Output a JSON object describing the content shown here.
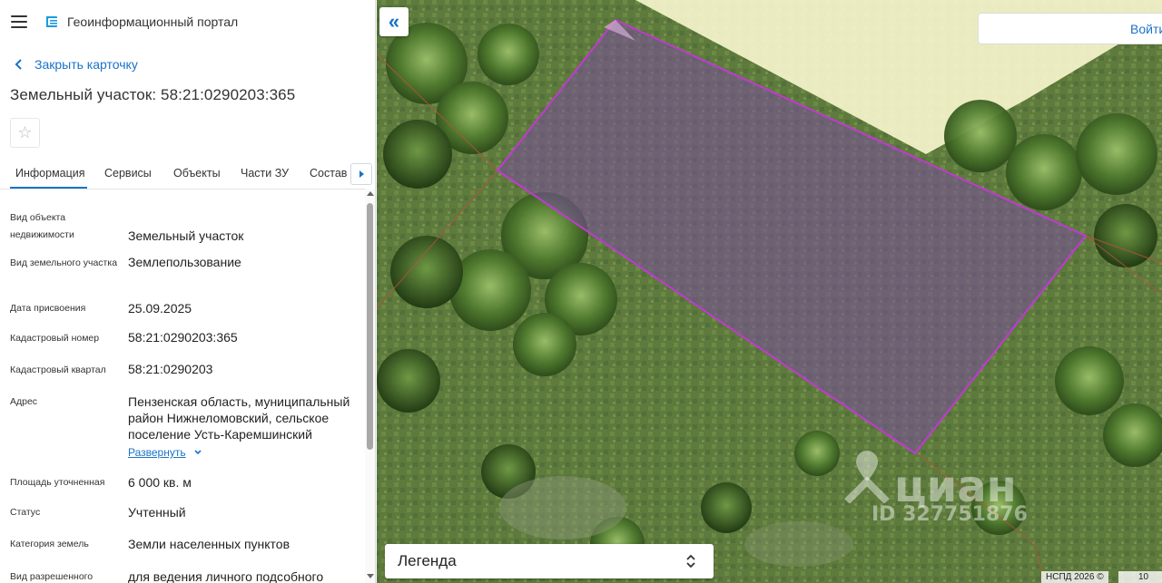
{
  "header": {
    "menu_icon": "hamburger-menu-icon",
    "logo_icon": "portal-logo-icon",
    "title": "Геоинформационный портал"
  },
  "card": {
    "back_label": "Закрыть карточку",
    "title": "Земельный участок: 58:21:0290203:365",
    "favorite_icon": "star-outline-icon"
  },
  "tabs": [
    {
      "label": "Информация",
      "active": true
    },
    {
      "label": "Сервисы"
    },
    {
      "label": "Объекты"
    },
    {
      "label": "Части ЗУ"
    },
    {
      "label": "Состав"
    }
  ],
  "info": [
    {
      "label": "Вид объекта недвижимости",
      "value": "Земельный участок"
    },
    {
      "label": "Вид земельного участка",
      "value": "Землепользование"
    },
    {
      "label": "Дата присвоения",
      "value": "25.09.2025"
    },
    {
      "label": "Кадастровый номер",
      "value": "58:21:0290203:365"
    },
    {
      "label": "Кадастровый квартал",
      "value": "58:21:0290203"
    },
    {
      "label": "Адрес",
      "value": "Пензенская область, муниципальный район Нижнеломовский, сельское поселение Усть-Каремшинский",
      "expand_label": "Развернуть"
    },
    {
      "label": "Площадь уточненная",
      "value": "6 000 кв. м"
    },
    {
      "label": "Статус",
      "value": "Учтенный"
    },
    {
      "label": "Категория земель",
      "value": "Земли населенных пунктов"
    },
    {
      "label": "Вид разрешенного",
      "value": "для ведения личного подсобного"
    }
  ],
  "map": {
    "collapse_symbol": "«",
    "login_label": "Войти",
    "legend_label": "Легенда",
    "watermark_brand": "циан",
    "watermark_id": "ID 327751876",
    "copyright": "НСПД 2026 ©",
    "scale_text": "10",
    "parcel_fill": "#7a4c9e",
    "parcel_stroke": "#c03ad0",
    "accent": "#1a73c8"
  }
}
